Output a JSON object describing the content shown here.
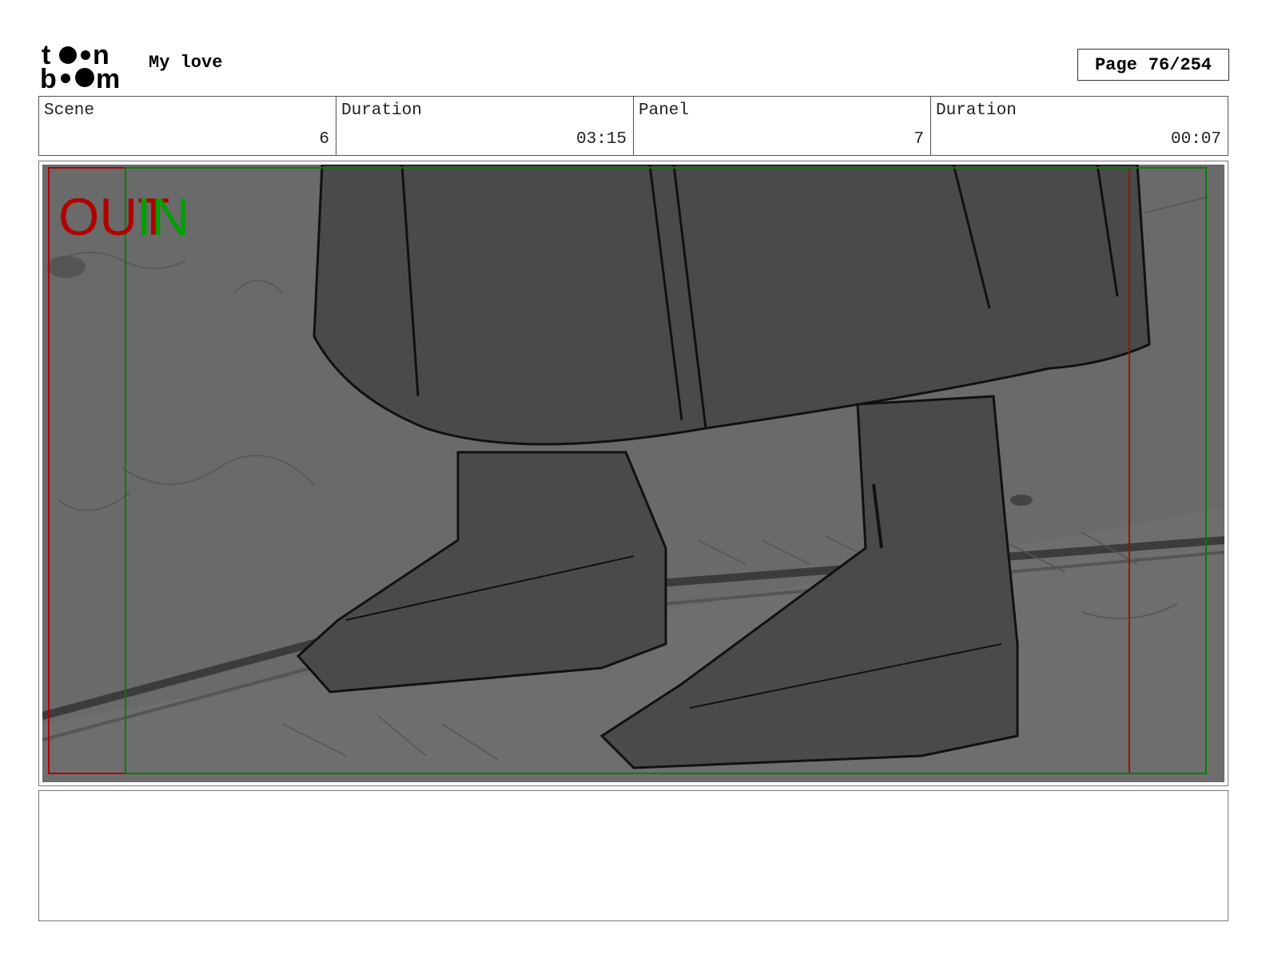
{
  "header": {
    "logo_text": [
      "toon",
      "boom"
    ],
    "project_title": "My love",
    "page_label": "Page",
    "page_value": "76/254"
  },
  "info": {
    "scene_label": "Scene",
    "scene_value": "6",
    "scene_duration_label": "Duration",
    "scene_duration_value": "03:15",
    "panel_label": "Panel",
    "panel_value": "7",
    "panel_duration_label": "Duration",
    "panel_duration_value": "00:07"
  },
  "panel": {
    "out_label": "OUT",
    "in_label": "IN",
    "out_color": "#b00000",
    "in_color": "#00a000"
  },
  "notes": {
    "text": ""
  }
}
